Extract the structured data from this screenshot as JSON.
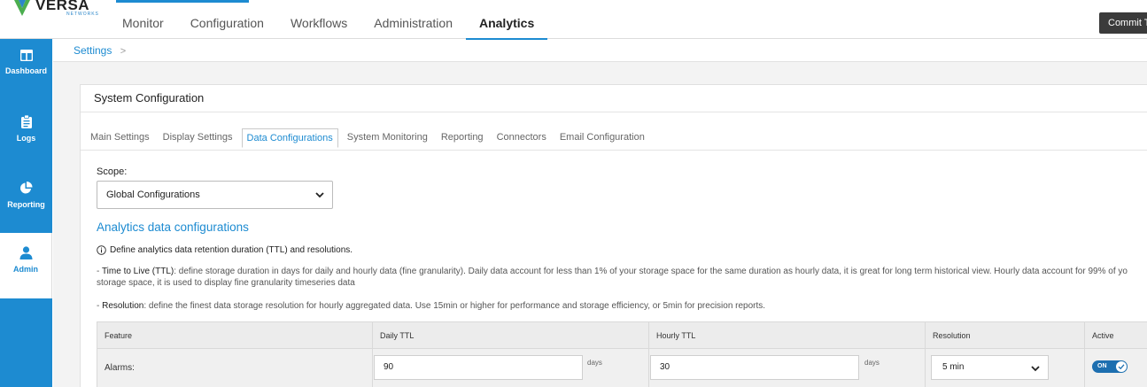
{
  "brand": {
    "name": "VERSA",
    "sub": "NETWORKS"
  },
  "topnav": [
    {
      "label": "Monitor",
      "active": false
    },
    {
      "label": "Configuration",
      "active": false
    },
    {
      "label": "Workflows",
      "active": false
    },
    {
      "label": "Administration",
      "active": false
    },
    {
      "label": "Analytics",
      "active": true
    }
  ],
  "commit_label": "Commit T",
  "sidebar": [
    {
      "label": "Dashboard",
      "icon": "dashboard-icon",
      "active": false
    },
    {
      "label": "Logs",
      "icon": "clipboard-icon",
      "active": false
    },
    {
      "label": "Reporting",
      "icon": "pie-chart-icon",
      "active": false
    },
    {
      "label": "Admin",
      "icon": "user-icon",
      "active": true
    }
  ],
  "breadcrumb": {
    "label": "Settings",
    "separator": ">"
  },
  "panel": {
    "title": "System Configuration",
    "tabs": [
      {
        "label": "Main Settings",
        "active": false
      },
      {
        "label": "Display Settings",
        "active": false
      },
      {
        "label": "Data Configurations",
        "active": true
      },
      {
        "label": "System Monitoring",
        "active": false
      },
      {
        "label": "Reporting",
        "active": false
      },
      {
        "label": "Connectors",
        "active": false
      },
      {
        "label": "Email Configuration",
        "active": false
      }
    ],
    "scope_label": "Scope:",
    "scope_value": "Global Configurations",
    "section_title": "Analytics data configurations",
    "info_text": "Define analytics data retention duration (TTL) and resolutions.",
    "ttl_prefix": "- ",
    "ttl_term": "Time to Live (TTL)",
    "ttl_line1": ": define storage duration in days for daily and hourly data (fine granularity). Daily data account for less than 1% of your storage space for the same duration as hourly data, it is great for long term historical view. Hourly data account for 99% of yo",
    "ttl_line2": "storage space, it is used to display fine granularity timeseries data",
    "res_prefix": "- ",
    "res_term": "Resolution",
    "res_text": ": define the finest data storage resolution for hourly aggregated data. Use 15min or higher for performance and storage efficiency, or 5min for precision reports.",
    "table": {
      "headers": [
        "Feature",
        "Daily TTL",
        "Hourly TTL",
        "Resolution",
        "Active"
      ],
      "rows": [
        {
          "feature": "Alarms:",
          "daily_ttl": "90",
          "daily_unit": "days",
          "hourly_ttl": "30",
          "hourly_unit": "days",
          "resolution": "5 min",
          "active": "ON"
        }
      ]
    }
  },
  "colors": {
    "accent": "#1d8bd1",
    "commit_bg": "#3b3b3b",
    "toggle_on": "#1d6fb0"
  }
}
